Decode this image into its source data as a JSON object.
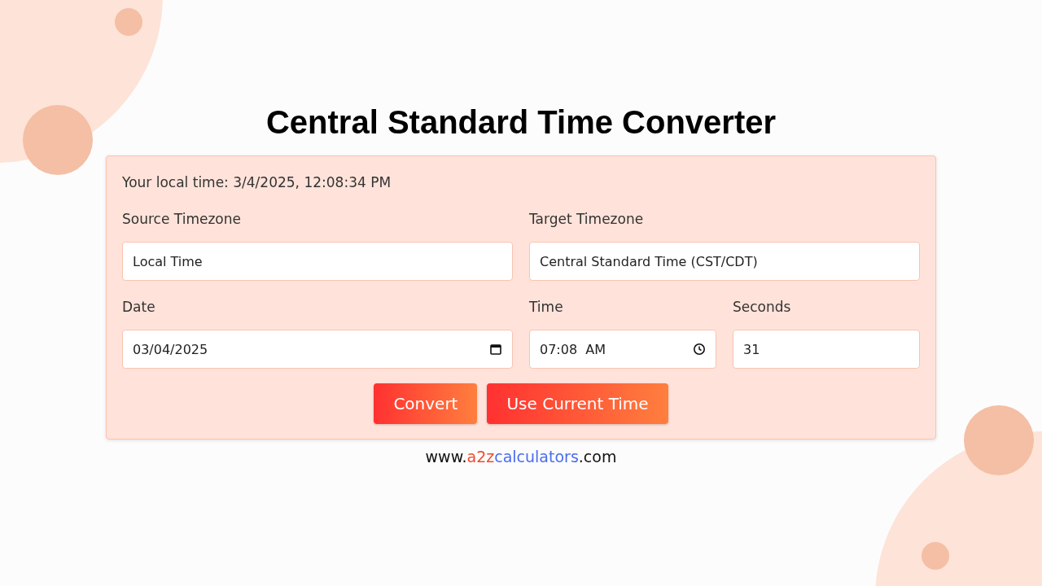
{
  "title": "Central Standard Time Converter",
  "local_time": "Your local time: 3/4/2025, 12:08:34 PM",
  "fields": [
    {
      "kind": "select",
      "label": "Source Timezone",
      "value": "Local Time"
    },
    {
      "kind": "select",
      "label": "Target Timezone",
      "value": "Central Standard Time (CST/CDT)"
    },
    {
      "kind": "date",
      "label": "Date",
      "value": "03/04/2025"
    },
    {
      "kind": "time",
      "label": "Time",
      "value": "07:08  AM"
    },
    {
      "kind": "number",
      "label": "Seconds",
      "value": "31"
    }
  ],
  "buttons": [
    "Convert",
    "Use Current Time"
  ],
  "footer_url": [
    {
      "text": "www.",
      "color": "#111111"
    },
    {
      "text": "a2z",
      "color": "#f04a2e"
    },
    {
      "text": "calculators",
      "color": "#4a6cf0"
    },
    {
      "text": ".com",
      "color": "#111111"
    }
  ]
}
